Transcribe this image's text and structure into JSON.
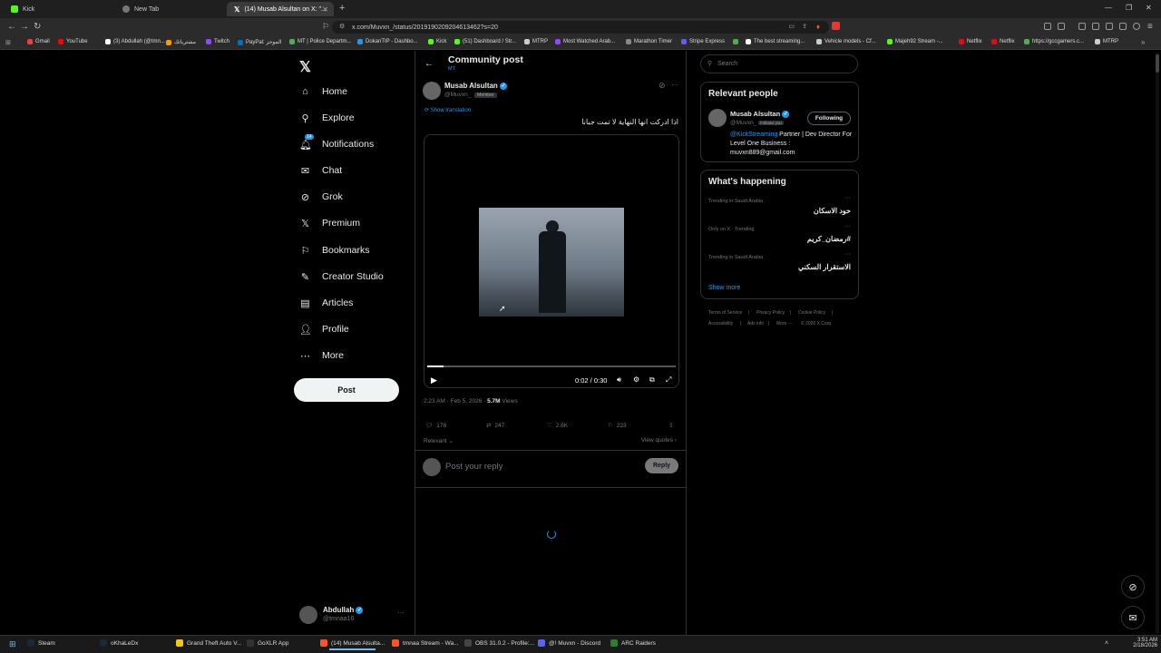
{
  "browser": {
    "tabs": [
      {
        "label": "Kick",
        "color": "#53fc18"
      },
      {
        "label": "New Tab",
        "color": "#888888"
      },
      {
        "label": "(14) Musab Alsultan on X: \"...",
        "color": "#ffffff"
      }
    ],
    "url": "x.com/Muvxn_/status/2019190209204613462?s=20",
    "bookmarks": [
      {
        "label": "Gmail",
        "color": "#ea4335"
      },
      {
        "label": "YouTube",
        "color": "#ff0000"
      },
      {
        "label": "(3) Abdullah (@tmn...",
        "color": "#ffffff"
      },
      {
        "label": "مشترياتك",
        "color": "#ff9900"
      },
      {
        "label": "Twitch",
        "color": "#9146ff"
      },
      {
        "label": "PayPal: الموجز",
        "color": "#0070ba"
      },
      {
        "label": "MT | Police Departm...",
        "color": "#4caf50"
      },
      {
        "label": "DokanTIP - Dashbo...",
        "color": "#2196f3"
      },
      {
        "label": "Kick",
        "color": "#53fc18"
      },
      {
        "label": "(51) Dashboard / Str...",
        "color": "#53fc18"
      },
      {
        "label": "MTRP",
        "color": "#cccccc"
      },
      {
        "label": "Most Watched Arab...",
        "color": "#9146ff"
      },
      {
        "label": "Marathon Timer",
        "color": "#888888"
      },
      {
        "label": "Stripe Express",
        "color": "#635bff"
      },
      {
        "label": "",
        "color": "#4caf50"
      },
      {
        "label": "The best streaming...",
        "color": "#ffffff"
      },
      {
        "label": "Vehicle models - Cf...",
        "color": "#cccccc"
      },
      {
        "label": "Majeh92 Stream -...",
        "color": "#53fc18"
      },
      {
        "label": "Netflix",
        "color": "#e50914"
      },
      {
        "label": "Netflix",
        "color": "#e50914"
      },
      {
        "label": "https://gccgamers.c...",
        "color": "#4caf50"
      },
      {
        "label": "MTRP",
        "color": "#cccccc"
      }
    ]
  },
  "nav": {
    "items": [
      {
        "label": "Home",
        "icon": "home-icon"
      },
      {
        "label": "Explore",
        "icon": "search-icon"
      },
      {
        "label": "Notifications",
        "icon": "bell-icon",
        "badge": "14"
      },
      {
        "label": "Chat",
        "icon": "mail-icon"
      },
      {
        "label": "Grok",
        "icon": "grok-icon"
      },
      {
        "label": "Premium",
        "icon": "x-icon"
      },
      {
        "label": "Bookmarks",
        "icon": "bookmark-icon"
      },
      {
        "label": "Creator Studio",
        "icon": "creator-icon"
      },
      {
        "label": "Articles",
        "icon": "articles-icon"
      },
      {
        "label": "Profile",
        "icon": "person-icon"
      },
      {
        "label": "More",
        "icon": "more-icon"
      }
    ],
    "post_label": "Post",
    "account": {
      "name": "Abdullah",
      "handle": "@tmnaa16"
    }
  },
  "post": {
    "header_title": "Community post",
    "community_tag": "MT",
    "author_name": "Musab Alsultan",
    "author_handle": "@Muvxn_",
    "member_badge": "Member",
    "show_translation": "Show translation",
    "text": "اذا ادركت انها النهاية لا تمت جبانا",
    "video": {
      "progress": 0.067,
      "time": "0:02 / 0:30"
    },
    "timestamp": "2:23 AM · Feb 5, 2026 · ",
    "views_count": "5.7M",
    "views_label": " Views",
    "stats": {
      "replies": "178",
      "reposts": "247",
      "likes": "2.6K",
      "bookmarks": "223"
    },
    "relevant_label": "Relevant",
    "view_quotes_label": "View quotes",
    "reply_placeholder": "Post your reply",
    "reply_button": "Reply"
  },
  "sidebar": {
    "search_placeholder": "Search",
    "relevant_people_title": "Relevant people",
    "person": {
      "name": "Musab Alsultan",
      "handle": "@Muvxn_",
      "follows_you": "Follows you",
      "following_label": "Following",
      "bio_mention": "@KickStreaming",
      "bio_rest": " Partner | Dev Director For Level One Business : muvxn889@gmail.com"
    },
    "happening_title": "What's happening",
    "trends": [
      {
        "meta": "Trending in Saudi Arabia",
        "title": "حود الاسكان"
      },
      {
        "meta": "Only on X · Trending",
        "title": "#رمضان_كريم"
      },
      {
        "meta": "Trending in Saudi Arabia",
        "title": "الاستقرار السكني"
      }
    ],
    "show_more": "Show more",
    "footer": [
      "Terms of Service",
      "|",
      "Privacy Policy",
      "|",
      "Cookie Policy",
      "|",
      "Accessibility",
      "|",
      "Ads info",
      "|",
      "More ···",
      "© 2026 X Corp."
    ]
  },
  "taskbar": {
    "items": [
      {
        "label": "Steam",
        "color": "#1b2838"
      },
      {
        "label": "oKhaLeDx",
        "color": "#1b2838"
      },
      {
        "label": "Grand Theft Auto V...",
        "color": "#f5c518"
      },
      {
        "label": "GoXLR App",
        "color": "#333333"
      },
      {
        "label": "(14) Musab Alsulta...",
        "color": "#fb542b"
      },
      {
        "label": "tmnaa Stream - Wa...",
        "color": "#fb542b"
      },
      {
        "label": "OBS 31.0.2 - Profile:...",
        "color": "#444444"
      },
      {
        "label": "@! Muvxn - Discord",
        "color": "#5865f2"
      },
      {
        "label": "ARC Raiders",
        "color": "#2e7d32"
      }
    ],
    "time": "3:51 AM",
    "date": "2/18/2026"
  },
  "colors": {
    "accent": "#1d9bf0",
    "background": "#000000",
    "border": "#2f3336"
  }
}
